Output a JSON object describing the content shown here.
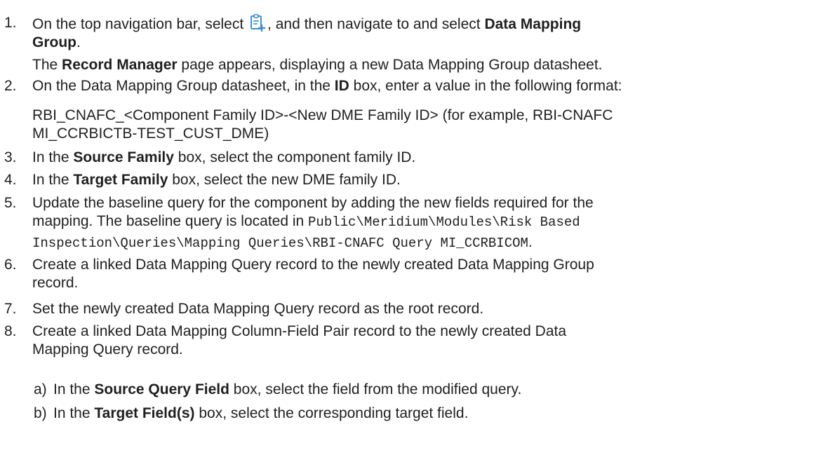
{
  "steps": [
    {
      "number": "1.",
      "pre": "On the top navigation bar, select",
      "icon": "new-record-icon",
      "mid": ", and then navigate to and select",
      "bold_1": "Data Mapping",
      "bold_2": "Group",
      "post": ".",
      "result_pre": "The",
      "result_bold": "Record Manager",
      "result_post": "page appears, displaying a new Data Mapping Group datasheet."
    },
    {
      "number": "2.",
      "pre": "On the Data Mapping Group datasheet, in the",
      "bold": "ID",
      "post": "box, enter a value in the following format:",
      "format_line_1": "RBI_CNAFC_<Component Family ID>-<New DME Family ID> (for example, RBI-CNAFC",
      "format_line_2": "MI_CCRBICTB-TEST_CUST_DME)"
    },
    {
      "number": "3.",
      "pre": "In the",
      "bold": "Source Family",
      "post": "box, select the component family ID."
    },
    {
      "number": "4.",
      "pre": "In the",
      "bold": "Target Family",
      "post": "box, select the new DME family ID."
    },
    {
      "number": "5.",
      "line_1": "Update the baseline query for the component by adding the new fields required for the",
      "line_2_pre": "mapping. The baseline query is located in",
      "path_1": "Public\\Meridium\\Modules\\Risk Based",
      "path_2": "Inspection\\Queries\\Mapping Queries\\RBI-CNAFC Query MI_CCRBICOM",
      "line_3_post": "."
    },
    {
      "number": "6.",
      "line_1": "Create a linked Data Mapping Query record to the newly created Data Mapping Group",
      "line_2": "record."
    },
    {
      "number": "7.",
      "line_1": "Set the newly created Data Mapping Query record as the root record."
    },
    {
      "number": "8.",
      "line_1": "Create a linked Data Mapping Column-Field Pair record to the newly created Data",
      "line_2": "Mapping Query record.",
      "substeps": [
        {
          "letter": "a)",
          "pre": "In the",
          "bold": "Source Query Field",
          "post": "box, select the field from the modified query."
        },
        {
          "letter": "b)",
          "pre": "In the",
          "bold": "Target Field(s)",
          "post": "box, select the corresponding target field."
        }
      ]
    }
  ],
  "colors": {
    "text": "#1f1f1f",
    "icon_blue": "#3a8fd6"
  }
}
